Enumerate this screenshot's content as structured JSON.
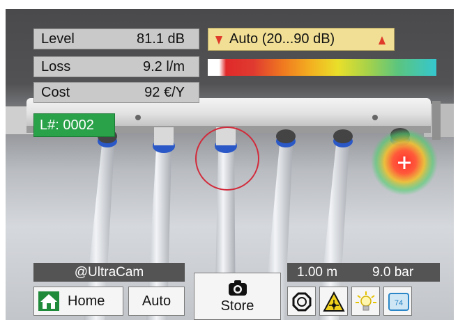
{
  "measurements": [
    {
      "label": "Level",
      "value": "81.1 dB"
    },
    {
      "label": "Loss",
      "value": "9.2 l/m"
    },
    {
      "label": "Cost",
      "value": "92 €/Y"
    }
  ],
  "range": {
    "label": "Auto (20...90 dB)"
  },
  "leak": {
    "id_label": "L#: 0002"
  },
  "status": {
    "camera_name": "@UltraCam",
    "distance": "1.00 m",
    "pressure": "9.0 bar"
  },
  "toolbar": {
    "home_label": "Home",
    "auto_label": "Auto",
    "store_label": "Store",
    "display_value": "74"
  },
  "icons": {
    "home": "home-icon",
    "camera": "camera-icon",
    "settings": "gear-icon",
    "laser": "laser-warning-icon",
    "light": "light-bulb-icon",
    "display": "display-icon"
  },
  "colors": {
    "measurement_bg": "#c9c9c9",
    "range_bg": "#f0df95",
    "leak_badge": "#2aa24a",
    "status_bar": "#545454"
  }
}
